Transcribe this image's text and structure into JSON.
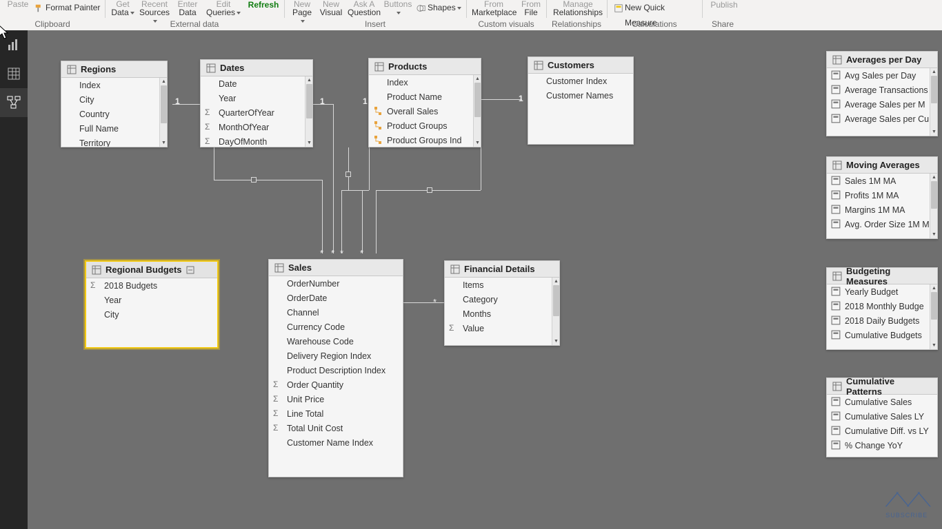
{
  "ribbon": {
    "paste": "Paste",
    "format_painter": "Format Painter",
    "get_data": "Get Data",
    "recent_sources": "Recent Sources",
    "enter_data": "Enter Data",
    "edit_queries": "Edit Queries",
    "refresh": "Refresh",
    "new_page": "New Page",
    "new_visual": "New Visual",
    "ask_a_question": "Ask A Question",
    "buttons": "Buttons",
    "shapes": "Shapes",
    "from_marketplace": "From Marketplace",
    "from_file": "From File",
    "manage_relationships": "Manage Relationships",
    "new_quick_measure": "New Quick Measure",
    "publish": "Publish",
    "groups": {
      "clipboard": "Clipboard",
      "external_data": "External data",
      "insert": "Insert",
      "custom_visuals": "Custom visuals",
      "relationships": "Relationships",
      "calculations": "Calculations",
      "share": "Share"
    }
  },
  "tables": {
    "regions": {
      "title": "Regions",
      "fields": [
        "Index",
        "City",
        "Country",
        "Full Name",
        "Territory"
      ]
    },
    "dates": {
      "title": "Dates",
      "fields": [
        {
          "n": "Date"
        },
        {
          "n": "Year"
        },
        {
          "n": "QuarterOfYear",
          "sigma": true
        },
        {
          "n": "MonthOfYear",
          "sigma": true
        },
        {
          "n": "DayOfMonth",
          "sigma": true
        }
      ]
    },
    "products": {
      "title": "Products",
      "fields": [
        {
          "n": "Index"
        },
        {
          "n": "Product Name"
        },
        {
          "n": "Overall Sales",
          "hier": true
        },
        {
          "n": "Product Groups",
          "hier": true
        },
        {
          "n": "Product Groups Ind",
          "hier": true
        }
      ]
    },
    "customers": {
      "title": "Customers",
      "fields": [
        "Customer Index",
        "Customer Names"
      ]
    },
    "regional_budgets": {
      "title": "Regional Budgets",
      "fields": [
        {
          "n": "2018 Budgets",
          "sigma": true
        },
        {
          "n": "Year"
        },
        {
          "n": "City"
        }
      ]
    },
    "sales": {
      "title": "Sales",
      "fields": [
        {
          "n": "OrderNumber"
        },
        {
          "n": "OrderDate"
        },
        {
          "n": "Channel"
        },
        {
          "n": "Currency Code"
        },
        {
          "n": "Warehouse Code"
        },
        {
          "n": "Delivery Region Index"
        },
        {
          "n": "Product Description Index"
        },
        {
          "n": "Order Quantity",
          "sigma": true
        },
        {
          "n": "Unit Price",
          "sigma": true
        },
        {
          "n": "Line Total",
          "sigma": true
        },
        {
          "n": "Total Unit Cost",
          "sigma": true
        },
        {
          "n": "Customer Name Index"
        }
      ]
    },
    "financial": {
      "title": "Financial Details",
      "fields": [
        {
          "n": "Items"
        },
        {
          "n": "Category"
        },
        {
          "n": "Months"
        },
        {
          "n": "Value",
          "sigma": true
        }
      ]
    },
    "averages_per_day": {
      "title": "Averages per Day",
      "fields": [
        "Avg Sales per Day",
        "Average Transactions",
        "Average Sales per M",
        "Average Sales per Cu"
      ]
    },
    "moving_averages": {
      "title": "Moving Averages",
      "fields": [
        "Sales 1M MA",
        "Profits 1M MA",
        "Margins 1M MA",
        "Avg. Order Size 1M M"
      ]
    },
    "budgeting_measures": {
      "title": "Budgeting Measures",
      "fields": [
        "Yearly Budget",
        "2018 Monthly Budge",
        "2018 Daily Budgets",
        "Cumulative Budgets"
      ]
    },
    "cumulative_patterns": {
      "title": "Cumulative Patterns",
      "fields": [
        "Cumulative Sales",
        "Cumulative Sales LY",
        "Cumulative Diff. vs LY",
        "% Change YoY"
      ]
    }
  },
  "rel_labels": {
    "one": "1",
    "many": "*"
  },
  "subscribe": "SUBSCRIBE"
}
